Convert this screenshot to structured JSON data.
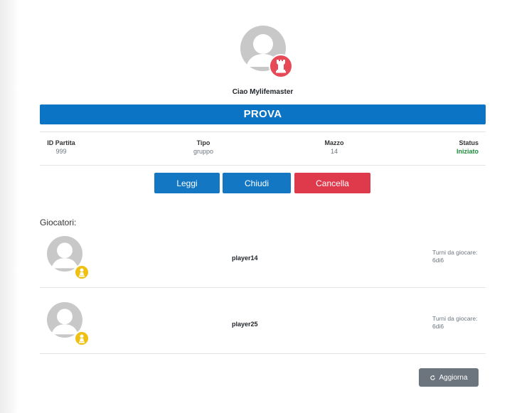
{
  "header": {
    "greeting": "Ciao Mylifemaster",
    "user_badge_icon": "chess-rook-icon"
  },
  "game": {
    "title": "PROVA",
    "info": [
      {
        "label": "ID Partita",
        "value": "999"
      },
      {
        "label": "Tipo",
        "value": "gruppo"
      },
      {
        "label": "Mazzo",
        "value": "14"
      },
      {
        "label": "Status",
        "value": "Iniziato"
      }
    ]
  },
  "actions": {
    "leggi": "Leggi",
    "chiudi": "Chiudi",
    "cancella": "Cancella"
  },
  "players": {
    "title": "Giocatori:",
    "list": [
      {
        "name": "player14",
        "turns_label": "Turni da giocare:",
        "turns_value": "6di6",
        "badge_icon": "chess-pawn-icon"
      },
      {
        "name": "player25",
        "turns_label": "Turni da giocare:",
        "turns_value": "6di6",
        "badge_icon": "chess-pawn-icon"
      }
    ]
  },
  "footer": {
    "refresh": "Aggiorna",
    "refresh_icon": "refresh-icon"
  },
  "colors": {
    "primary": "#0c74c4",
    "danger": "#de3a4c",
    "success": "#1e8a3a",
    "secondary": "#6c757d",
    "pawn_badge": "#f0c010",
    "rook_badge": "#e64a56"
  }
}
